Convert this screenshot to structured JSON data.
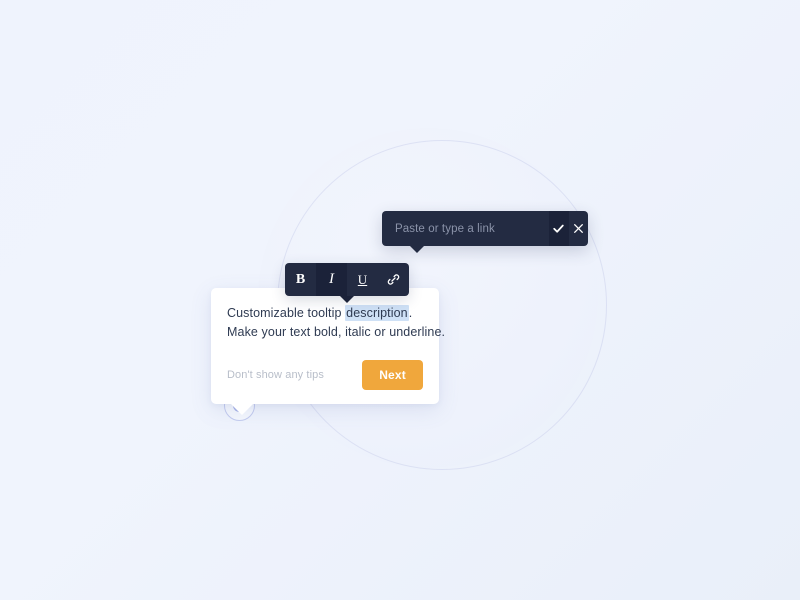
{
  "background": {
    "gradient_from": "#eff3fd",
    "gradient_to": "#e9eff9",
    "circle_fill": "#eef2fc",
    "circle_ring": "#acb5e0"
  },
  "target_marker": {
    "name": "tooltip-anchor-dot",
    "ring_color": "#c3cbef",
    "dot_color": "#a7b2e6"
  },
  "format_toolbar": {
    "background": "#232b42",
    "active_background": "#1b2239",
    "buttons": [
      {
        "id": "bold",
        "label": "B",
        "icon": "bold-icon",
        "active": false
      },
      {
        "id": "italic",
        "label": "I",
        "icon": "italic-icon",
        "active": true
      },
      {
        "id": "underline",
        "label": "U",
        "icon": "underline-icon",
        "active": false
      },
      {
        "id": "link",
        "label": "",
        "icon": "link-chain-icon",
        "active": false
      }
    ]
  },
  "link_popup": {
    "background": "#232b42",
    "input": {
      "value": "",
      "placeholder": "Paste or type a link"
    },
    "confirm_label": "✔",
    "cancel_label": "✕"
  },
  "tooltip_card": {
    "background": "#ffffff",
    "line1_prefix": "Customizable tooltip ",
    "line1_highlight": "description",
    "line1_suffix": ".",
    "line2": "Make your text bold, italic or underline.",
    "highlight_color": "#cfe1f6",
    "dismiss_label": "Don't show any tips",
    "next_label": "Next",
    "next_color": "#f0a73c"
  }
}
